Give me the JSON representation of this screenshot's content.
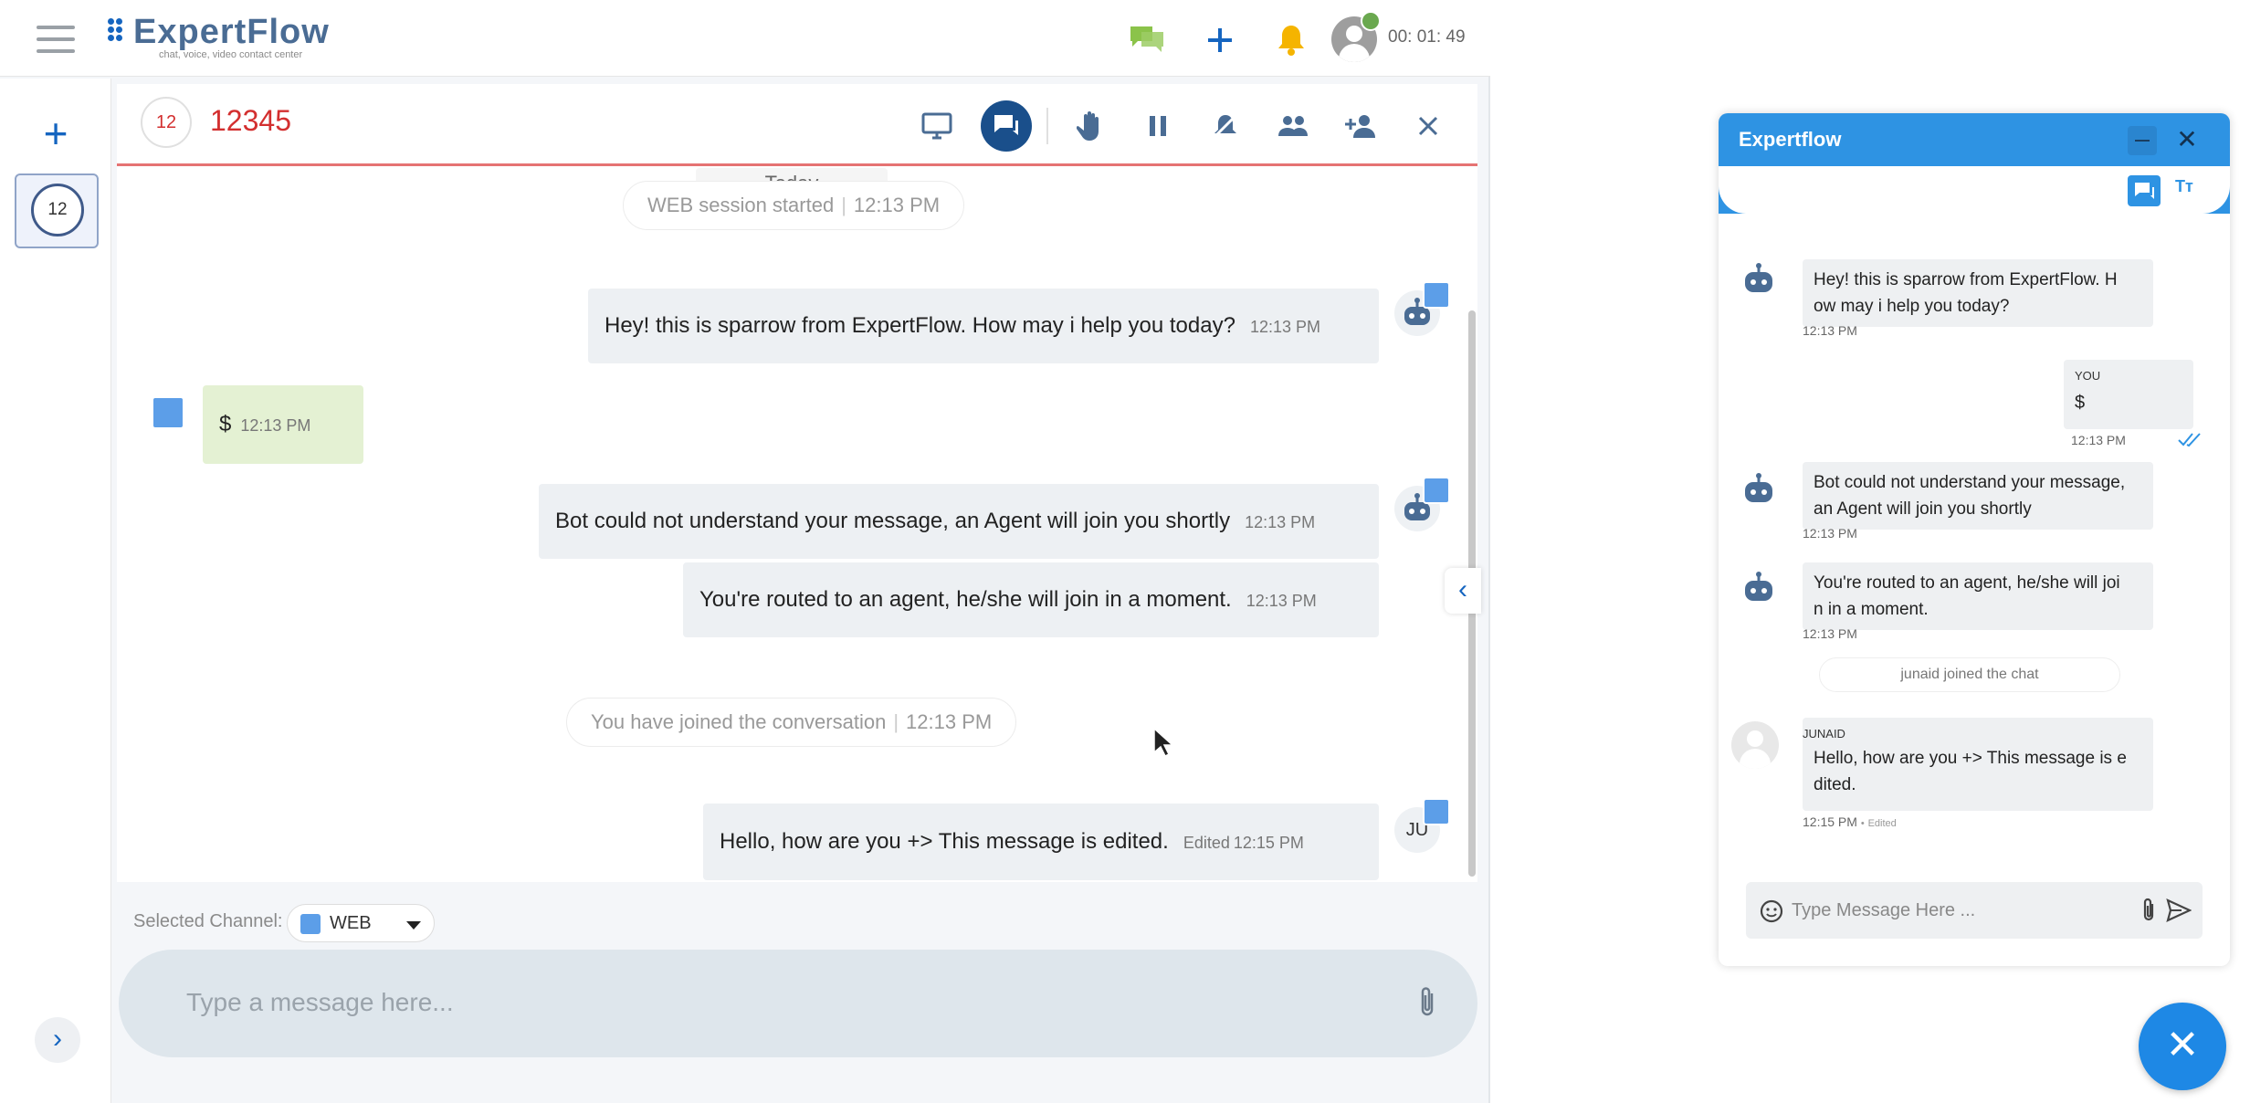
{
  "app": {
    "logo_name": "ExpertFlow",
    "logo_tagline": "chat, voice, video contact center",
    "timer": "00: 01: 49"
  },
  "leftbar": {
    "conversation_badge": "12"
  },
  "conversation": {
    "badge": "12",
    "name": "12345"
  },
  "chat": {
    "date_label": "Today",
    "session_started": "WEB session started",
    "session_started_time": "12:13 PM",
    "joined_text": "You have joined the conversation",
    "joined_time": "12:13 PM",
    "messages": [
      {
        "text": "Hey! this is sparrow from ExpertFlow. How may i help you today?",
        "time": "12:13 PM"
      },
      {
        "text": "$",
        "time": "12:13 PM"
      },
      {
        "text": "Bot could not understand your message, an Agent will join you shortly",
        "time": "12:13 PM"
      },
      {
        "text": "You're routed to an agent, he/she will join in a moment.",
        "time": "12:13 PM"
      },
      {
        "text": "Hello, how are you +> This message is edited.",
        "edited_label": "Edited",
        "time": "12:15 PM"
      }
    ],
    "agent_initials": "JU"
  },
  "channel": {
    "label": "Selected Channel:",
    "value": "WEB"
  },
  "composer": {
    "placeholder": "Type a message here..."
  },
  "widget": {
    "title": "Expertflow",
    "font_tool": "Tт",
    "messages": [
      {
        "text": "Hey! this is sparrow from ExpertFlow. H\now may i help you today?",
        "time": "12:13 PM"
      },
      {
        "sender": "YOU",
        "text": "$",
        "time": "12:13 PM"
      },
      {
        "text": "Bot could not understand your message,\nan Agent will join you shortly",
        "time": "12:13 PM"
      },
      {
        "text": "You're routed to an agent, he/she will joi\nn in a moment.",
        "time": "12:13 PM"
      },
      {
        "sender": "JUNAID",
        "text": "Hello, how are you +> This message is e\ndited.",
        "time": "12:15 PM",
        "edited_label": "Edited"
      }
    ],
    "joined_text": "junaid joined the chat",
    "input_placeholder": "Type Message Here ..."
  },
  "icons": {
    "topbar": [
      "chat-bubbles-icon",
      "plus-icon",
      "bell-icon",
      "user-avatar-icon"
    ],
    "conversation_actions": [
      "monitor-icon",
      "chat-icon",
      "hand-icon",
      "pause-icon",
      "mute-icon",
      "group-icon",
      "add-user-icon",
      "close-icon"
    ]
  },
  "colors": {
    "brand_blue": "#1565c0",
    "conversation_red": "#d32f2f",
    "widget_blue": "#2e93e3",
    "online_green": "#6aa84f",
    "bell_yellow": "#f5b400"
  }
}
